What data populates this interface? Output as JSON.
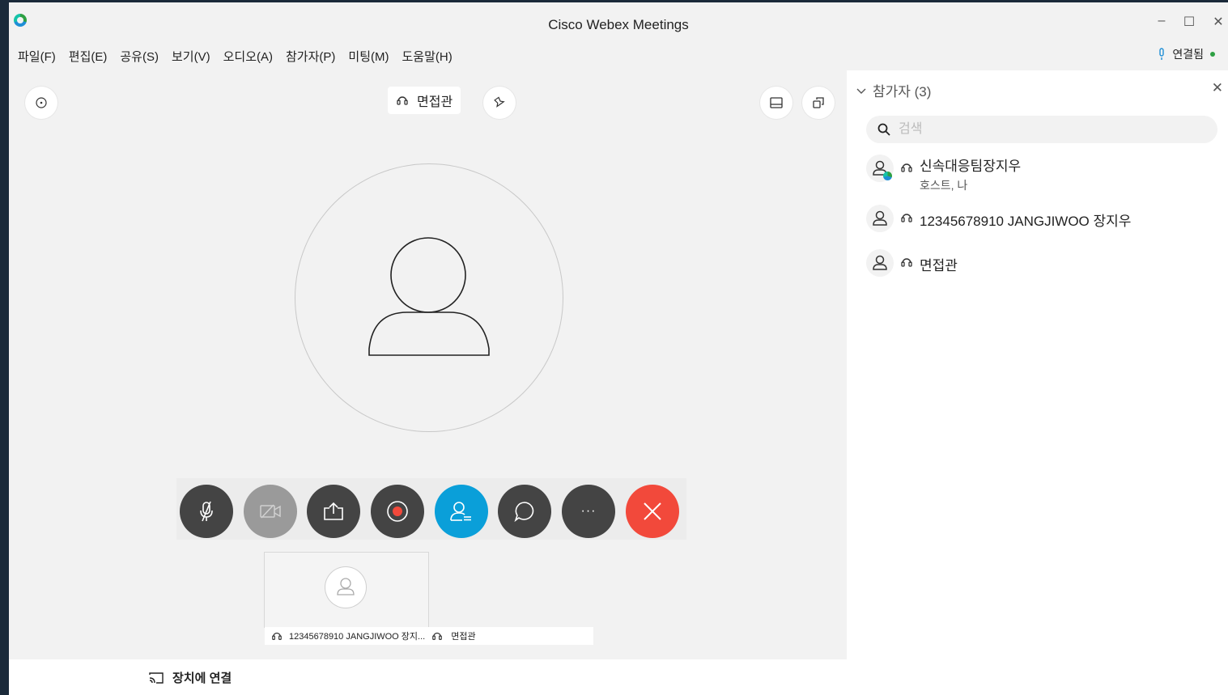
{
  "window": {
    "title": "Cisco Webex Meetings",
    "controls": {
      "minimize": "–",
      "maximize": "☐",
      "close": "✕"
    }
  },
  "menu": [
    {
      "label": "파일(F)"
    },
    {
      "label": "편집(E)"
    },
    {
      "label": "공유(S)"
    },
    {
      "label": "보기(V)"
    },
    {
      "label": "오디오(A)"
    },
    {
      "label": "참가자(P)"
    },
    {
      "label": "미팅(M)"
    },
    {
      "label": "도움말(H)"
    }
  ],
  "connection": {
    "status": "연결됨",
    "color": "#2ea043"
  },
  "stage": {
    "active_speaker": "면접관",
    "thumbnail": {
      "label1": "12345678910 JANGJIWOO 장지...",
      "label2": "면접관"
    }
  },
  "controls": {
    "mute": "microphone-muted-icon",
    "video": "video-off-icon",
    "share": "share-icon",
    "record": "record-icon",
    "participants": "participants-icon",
    "chat": "chat-icon",
    "more": "···",
    "end": "✕",
    "colors": {
      "dark": "#444444",
      "disabled": "#9a9a9a",
      "accent": "#0a9fd9",
      "danger": "#f2493b"
    }
  },
  "panel": {
    "title": "참가자 (3)",
    "close": "✕",
    "search": {
      "placeholder": "검색",
      "value": ""
    },
    "participants": [
      {
        "name": "신속대응팀장지우",
        "role": "호스트, 나"
      },
      {
        "name": "12345678910 JANGJIWOO 장지우",
        "role": ""
      },
      {
        "name": "면접관",
        "role": ""
      }
    ]
  },
  "footer": {
    "connect_device": "장치에 연결"
  }
}
